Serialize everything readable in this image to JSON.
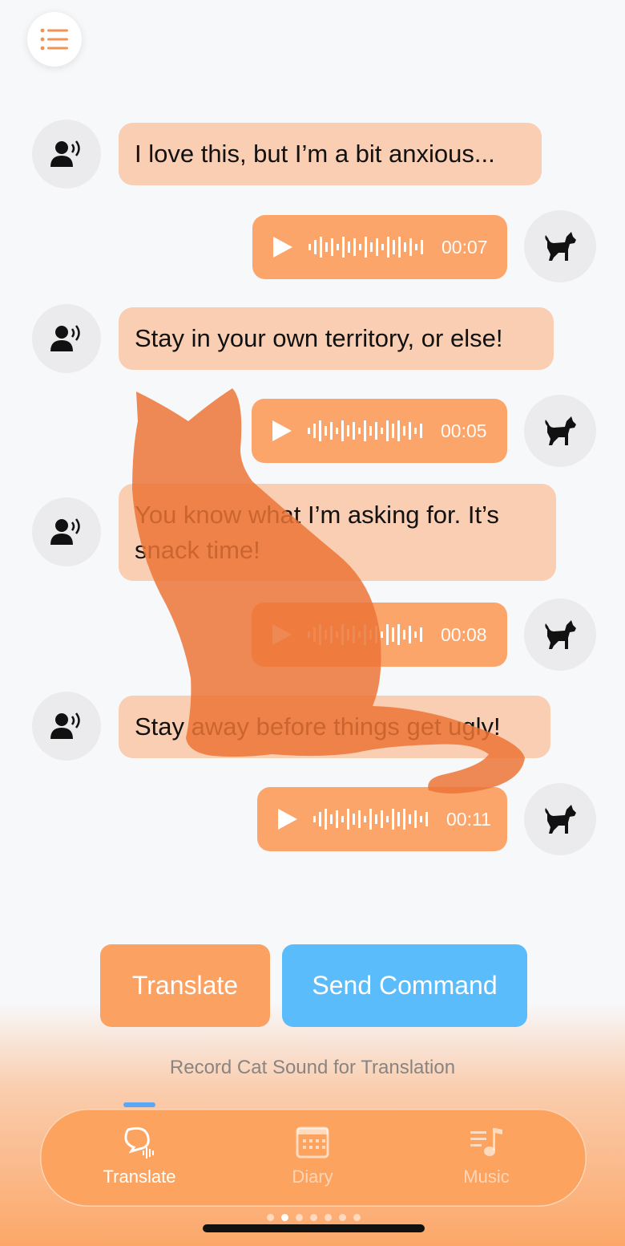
{
  "messages": [
    {
      "type": "human",
      "text": "I love this, but I’m a bit anxious..."
    },
    {
      "type": "cat",
      "duration": "00:07"
    },
    {
      "type": "human",
      "text": "Stay in your own territory, or else!"
    },
    {
      "type": "cat",
      "duration": "00:05"
    },
    {
      "type": "human",
      "text": "You know what I’m asking for. It’s snack time!"
    },
    {
      "type": "cat",
      "duration": "00:08"
    },
    {
      "type": "human",
      "text": "Stay away before things get ugly!"
    },
    {
      "type": "cat",
      "duration": "00:11"
    }
  ],
  "actions": {
    "translate": "Translate",
    "send_command": "Send Command"
  },
  "hint": "Record Cat Sound for Translation",
  "tabs": [
    {
      "label": "Translate",
      "icon": "chat-wave-icon",
      "active": true
    },
    {
      "label": "Diary",
      "icon": "calendar-icon",
      "active": false
    },
    {
      "label": "Music",
      "icon": "music-list-icon",
      "active": false
    }
  ],
  "page_indicator": {
    "count": 7,
    "current": 1
  },
  "colors": {
    "accent_orange": "#fba263",
    "accent_blue": "#5bbcfc",
    "bubble": "#fbc4a0",
    "silhouette": "#ec7436"
  }
}
